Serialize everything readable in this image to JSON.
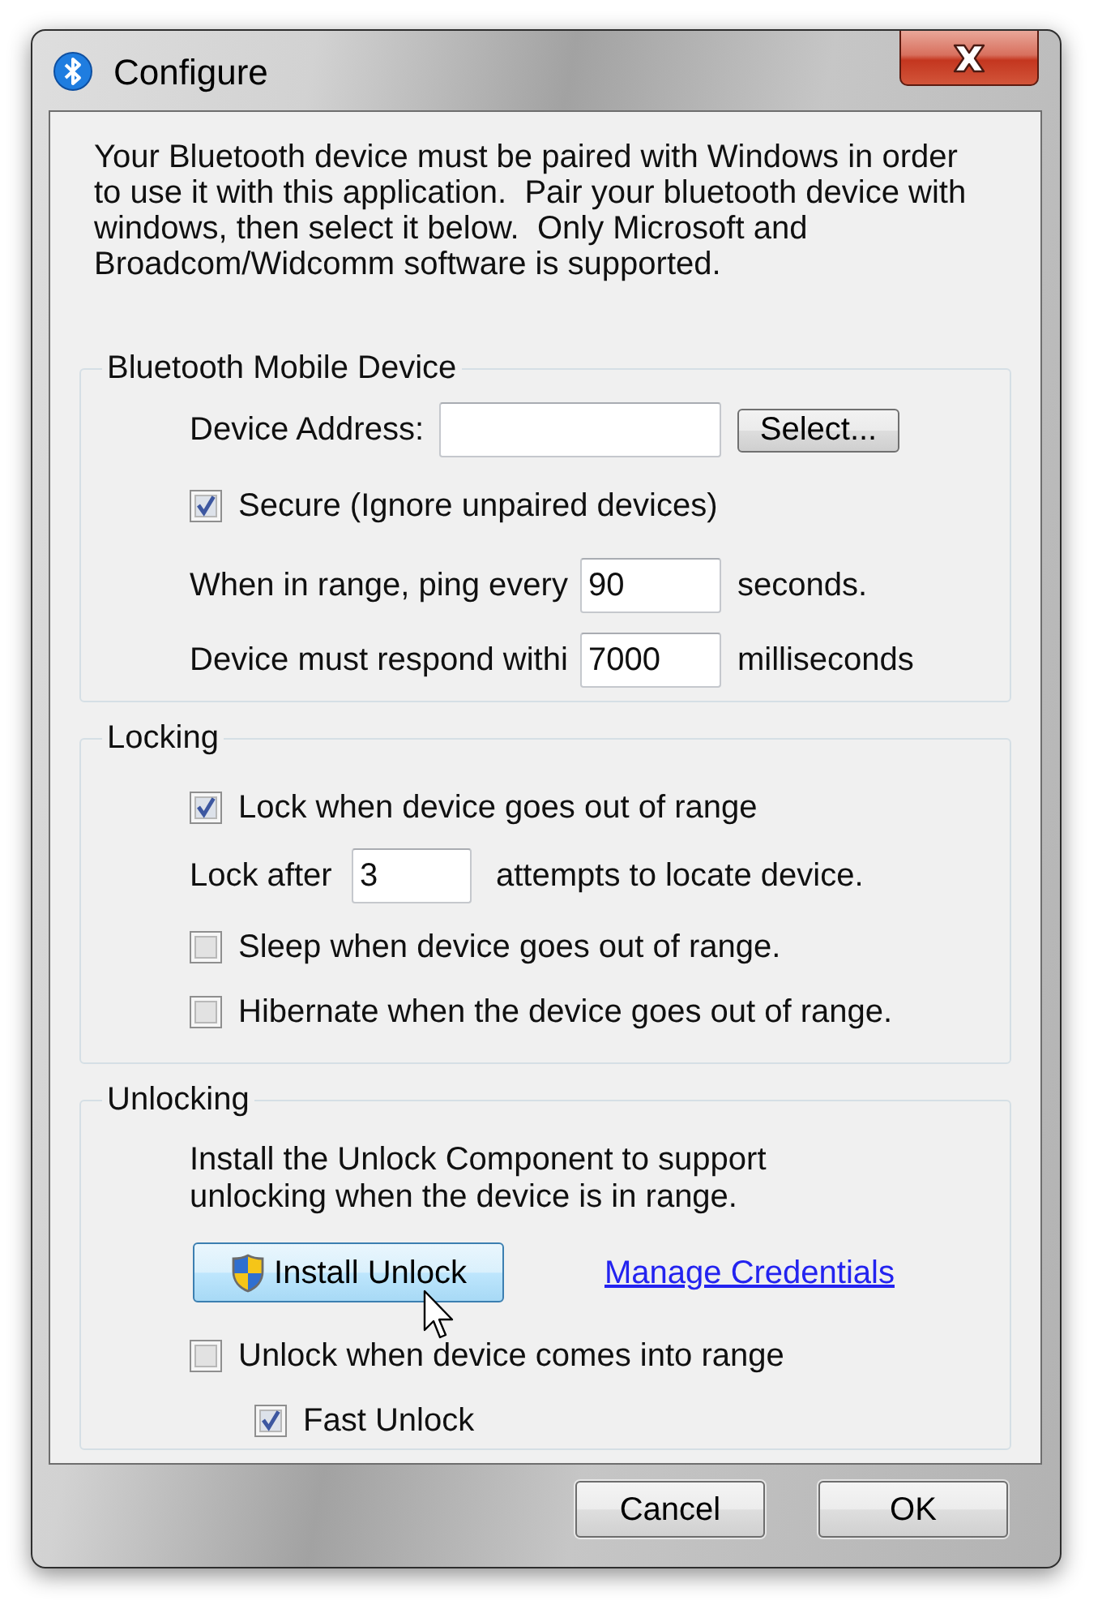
{
  "window": {
    "title": "Configure"
  },
  "intro": "Your Bluetooth device must be paired with Windows in order to use it with this application.  Pair your bluetooth device with windows, then select it below.  Only Microsoft and Broadcom/Widcomm software is supported.",
  "groups": [
    {
      "title": "Bluetooth Mobile Device",
      "rows": [
        {
          "kind": "address",
          "label": "Device Address:",
          "button": "Select..."
        },
        {
          "kind": "checkbox",
          "label": "Secure (Ignore unpaired devices)",
          "checked": true
        },
        {
          "kind": "field",
          "label": "When in range, ping every",
          "value": "90",
          "unit": "seconds."
        },
        {
          "kind": "field",
          "label": "Device must respond withi",
          "value": "7000",
          "unit": "milliseconds"
        }
      ]
    },
    {
      "title": "Locking",
      "rows": [
        {
          "kind": "checkbox",
          "label": "Lock when device goes out of range",
          "checked": true
        },
        {
          "kind": "field",
          "label": "Lock after",
          "value": "3",
          "unit": "attempts to locate device."
        },
        {
          "kind": "checkbox",
          "label": "Sleep when device goes out of range.",
          "checked": false
        },
        {
          "kind": "checkbox",
          "label": "Hibernate when the device goes out of range.",
          "checked": false
        }
      ]
    },
    {
      "title": "Unlocking",
      "rows": [
        {
          "kind": "text",
          "text": "Install the Unlock Component to support unlocking when the device is in range."
        },
        {
          "kind": "actions",
          "button": "Install Unlock",
          "link": "Manage Credentials"
        },
        {
          "kind": "checkbox",
          "label": "Unlock when device comes into range",
          "checked": false,
          "children": [
            {
              "label": "Fast Unlock",
              "checked": true
            }
          ]
        }
      ]
    }
  ],
  "buttons": [
    "Cancel",
    "OK"
  ]
}
